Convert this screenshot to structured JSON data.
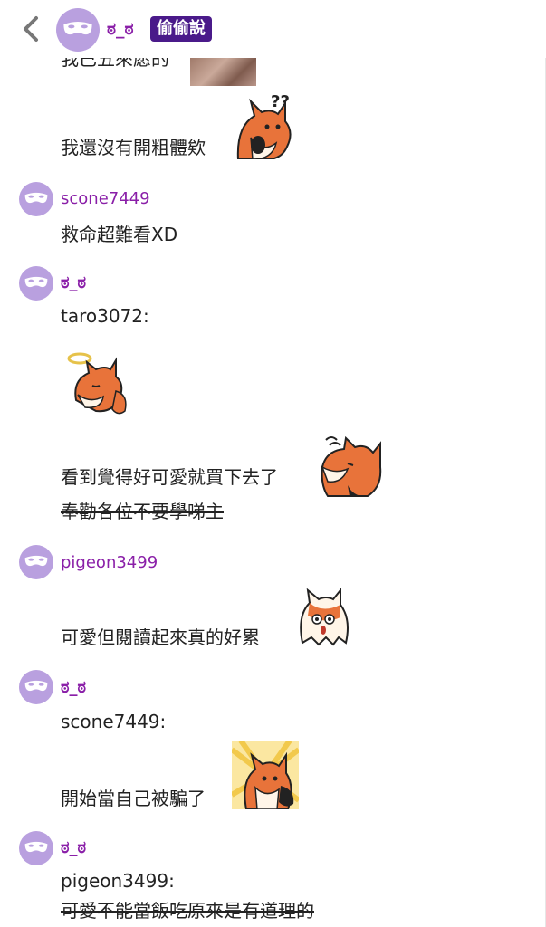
{
  "header": {
    "name": "ಠ_ಠ",
    "badge": "偷偷說"
  },
  "messages": {
    "m0_text": "我已五來愿的",
    "m0_line": "我還沒有開粗體欸",
    "m1_user": "scone7449",
    "m1_text": "救命超難看XD",
    "m2_user": "ಠ_ಠ",
    "m2_quote": "taro3072:",
    "m2_text": "看到覺得好可愛就買下去了",
    "m2_strike": "奉勸各位不要學㖒主",
    "m3_user": "pigeon3499",
    "m3_text": "可愛但閱讀起來真的好累",
    "m4_user": "ಠ_ಠ",
    "m4_quote": "scone7449:",
    "m4_text": "開始當自己被騙了",
    "m5_user": "ಠ_ಠ",
    "m5_quote": "pigeon3499:",
    "m5_strike": "可愛不能當飯吃原來是有道理的"
  },
  "colors": {
    "accent_purple": "#8a1fa8",
    "badge_bg": "#4a1a8a",
    "avatar_bg": "#b9a0df",
    "fox_orange": "#e8733a"
  },
  "icons": [
    "chevron-left-icon",
    "mask-avatar-icon",
    "fox-sticker"
  ]
}
